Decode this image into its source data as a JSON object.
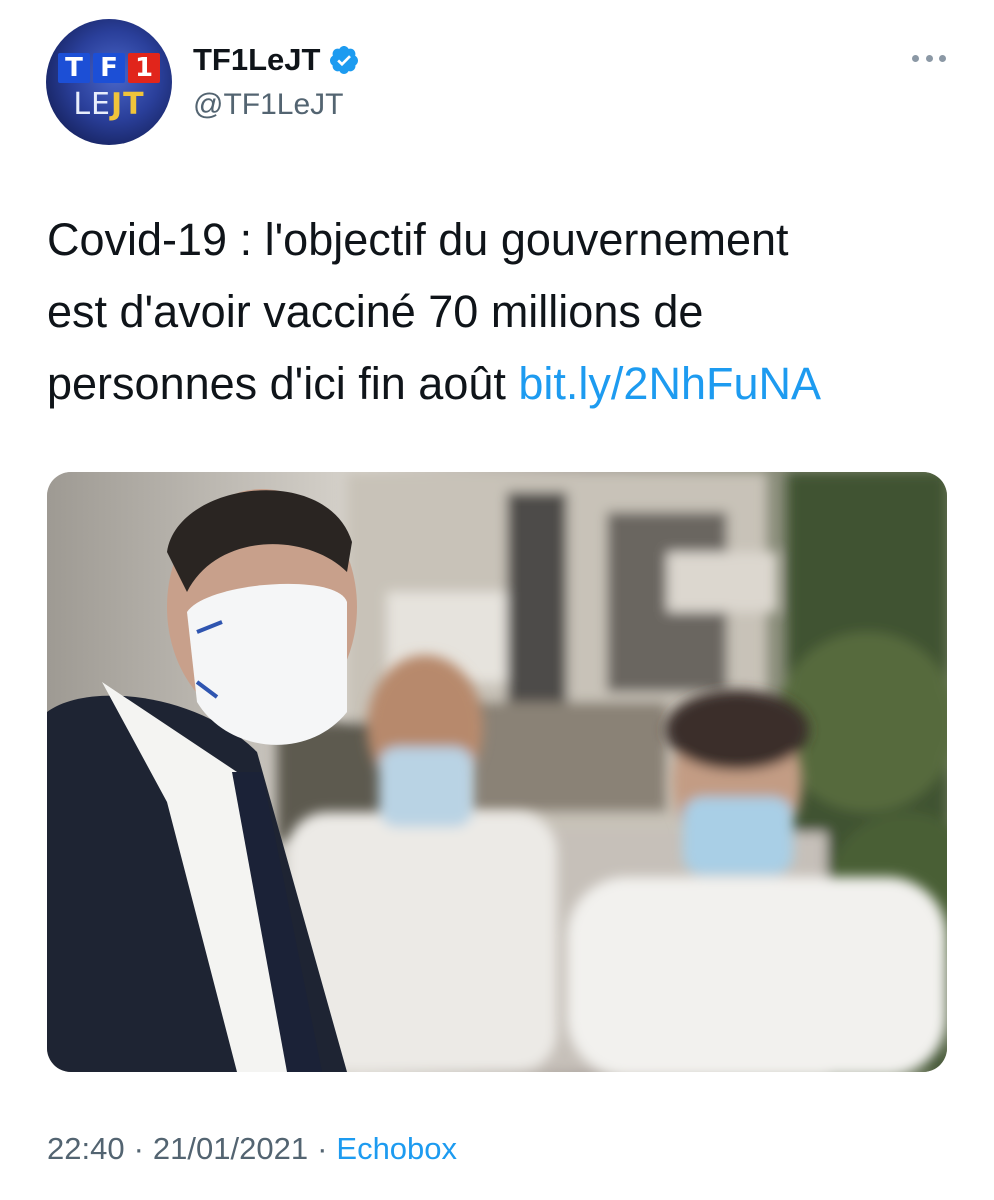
{
  "author": {
    "display_name": "TF1LeJT",
    "handle": "@TF1LeJT",
    "verified": true,
    "avatar": {
      "letters": [
        "T",
        "F",
        "1"
      ],
      "caption_light": "LE",
      "caption_bold": "JT"
    }
  },
  "tweet": {
    "text_line1": "Covid-19 : l'objectif du gouvernement",
    "text_line2": "est d'avoir vacciné 70 millions de",
    "text_line3": "personnes d'ici fin août ",
    "link": "bit.ly/2NhFuNA"
  },
  "meta": {
    "time": "22:40",
    "date": "21/01/2021",
    "source": "Echobox",
    "separator": "·"
  },
  "icons": {
    "more": "more-horizontal-icon",
    "verified": "verified-badge-icon"
  },
  "colors": {
    "link": "#1d9bf0",
    "secondary_text": "#536471",
    "primary_text": "#0f1419"
  }
}
